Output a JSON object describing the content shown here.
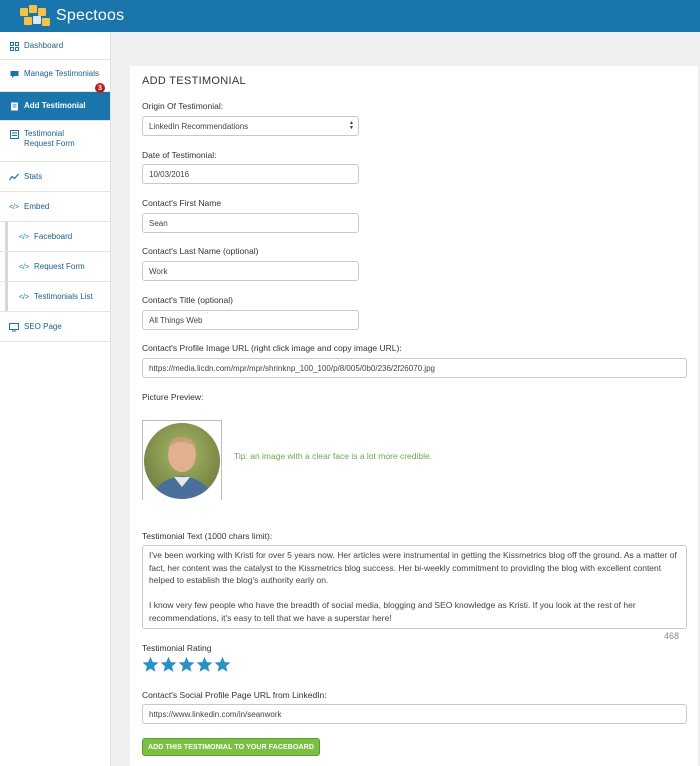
{
  "app": {
    "brand": "Spectoos"
  },
  "sidebar": {
    "items": [
      {
        "label": "Dashboard",
        "icon": "grid-icon"
      },
      {
        "label": "Manage Testimonials",
        "icon": "comment-icon"
      },
      {
        "label": "Add Testimonial",
        "icon": "doc-icon"
      },
      {
        "label": "Testimonial Request Form",
        "icon": "form-icon"
      },
      {
        "label": "Stats",
        "icon": "chart-line-icon"
      },
      {
        "label": "Embed",
        "icon": "code-icon"
      },
      {
        "label": "Faceboard",
        "icon": "code-icon"
      },
      {
        "label": "Request Form",
        "icon": "code-icon"
      },
      {
        "label": "Testimonials List",
        "icon": "code-icon"
      },
      {
        "label": "SEO Page",
        "icon": "monitor-icon"
      }
    ],
    "badge": "3"
  },
  "form": {
    "title": "ADD TESTIMONIAL",
    "origin_label": "Origin Of Testimonial:",
    "origin_value": "LinkedIn Recommendations",
    "date_label": "Date of Testimonial:",
    "date_value": "10/03/2016",
    "first_name_label": "Contact's First Name",
    "first_name_value": "Sean",
    "last_name_label": "Contact's Last Name (optional)",
    "last_name_value": "Work",
    "title_label": "Contact's Title (optional)",
    "title_value": "All Things Web",
    "image_url_label": "Contact's Profile Image URL (right click image and copy image URL):",
    "image_url_value": "https://media.licdn.com/mpr/mpr/shrinknp_100_100/p/8/005/0b0/236/2f26070.jpg",
    "preview_label": "Picture Preview:",
    "tip": "Tip: an image with a clear face is a lot more credible.",
    "text_label": "Testimonial Text (1000 chars limit):",
    "text_value": "I've been working with Kristi for over 5 years now. Her articles were instrumental in getting the Kissmetrics blog off the ground. As a matter of fact, her content was the catalyst to the Kissmetrics blog success. Her bi-weekly commitment to providing the blog with excellent content helped to establish the blog's authority early on.\n\nI know very few people who have the breadth of social media, blogging and SEO knowledge as Kristi. If you look at the rest of her recommendations, it's easy to tell that we have a superstar here!",
    "char_count": "468",
    "rating_label": "Testimonial Rating",
    "rating": 5,
    "rating_max": 5,
    "social_label": "Contact's Social Profile Page URL from LinkedIn:",
    "social_value": "https://www.linkedin.com/in/seanwork",
    "submit_label": "ADD THIS TESTIMONIAL TO YOUR FACEBOARD"
  },
  "colors": {
    "header": "#1b75ad",
    "active_nav": "#1b75ad",
    "star": "#2a8fc5",
    "submit": "#7ac143",
    "tip": "#6aa84f"
  }
}
